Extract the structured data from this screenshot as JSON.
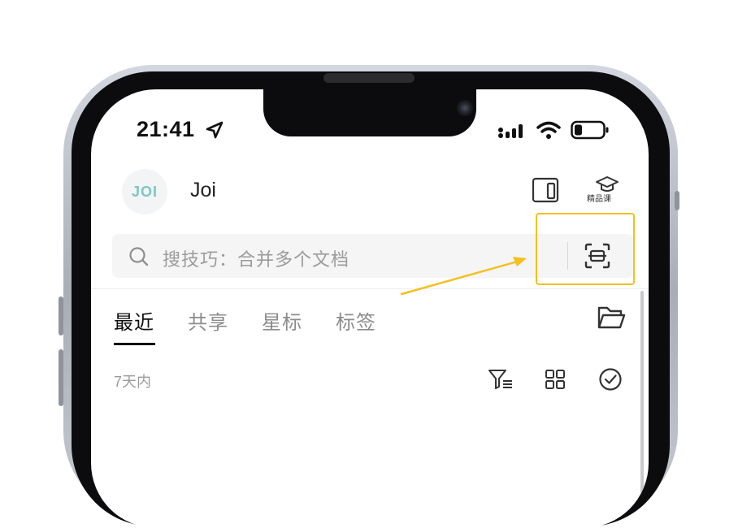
{
  "status_bar": {
    "time": "21:41"
  },
  "header": {
    "avatar_text": "JOI",
    "username": "Joi",
    "premium_course_label": "精品课"
  },
  "search": {
    "placeholder": "搜技巧：合并多个文档"
  },
  "tabs": [
    {
      "label": "最近",
      "active": true
    },
    {
      "label": "共享",
      "active": false
    },
    {
      "label": "星标",
      "active": false
    },
    {
      "label": "标签",
      "active": false
    }
  ],
  "section": {
    "label": "7天内"
  },
  "colors": {
    "highlight": "#f3c01f",
    "avatar_accent": "#7bc7c3"
  },
  "icons": [
    "location-arrow-icon",
    "signal-icon",
    "wifi-icon",
    "battery-icon",
    "tablet-icon",
    "graduation-cap-icon",
    "search-icon",
    "scan-icon",
    "folder-icon",
    "filter-icon",
    "grid-view-icon",
    "check-circle-icon"
  ]
}
